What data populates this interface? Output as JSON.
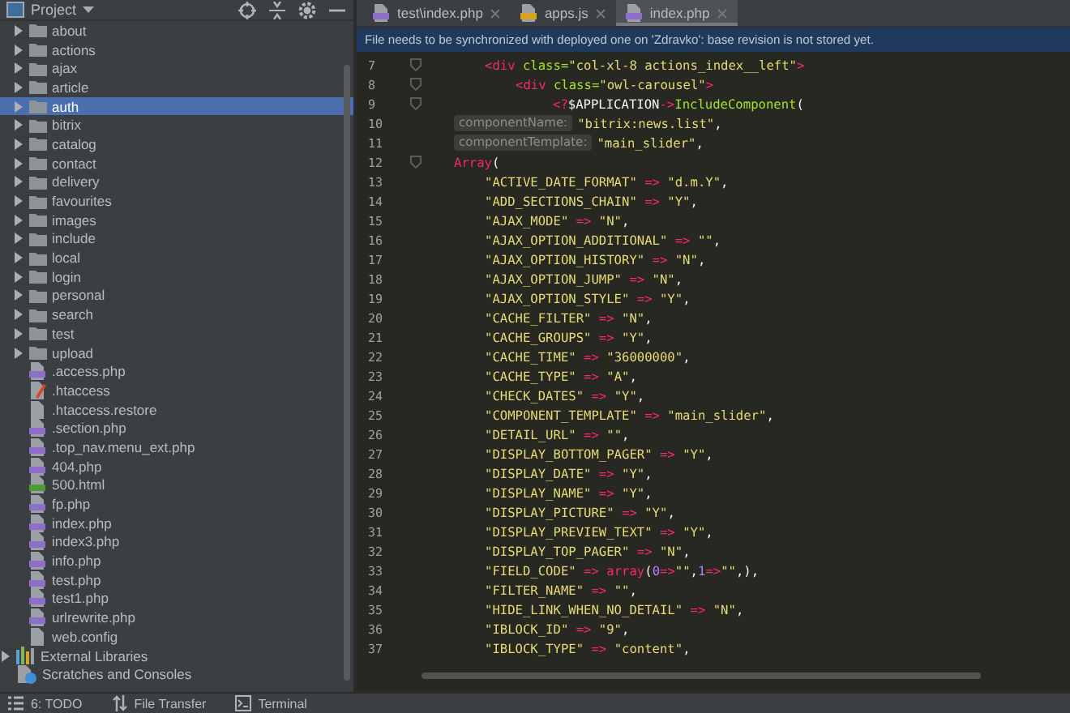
{
  "project_panel": {
    "title": "Project",
    "items": [
      {
        "label": "about",
        "kind": "folder",
        "expanded": false,
        "selected": false
      },
      {
        "label": "actions",
        "kind": "folder",
        "expanded": false,
        "selected": false
      },
      {
        "label": "ajax",
        "kind": "folder",
        "expanded": false,
        "selected": false
      },
      {
        "label": "article",
        "kind": "folder",
        "expanded": false,
        "selected": false
      },
      {
        "label": "auth",
        "kind": "folder",
        "expanded": false,
        "selected": true
      },
      {
        "label": "bitrix",
        "kind": "folder",
        "expanded": false,
        "selected": false
      },
      {
        "label": "catalog",
        "kind": "folder",
        "expanded": false,
        "selected": false
      },
      {
        "label": "contact",
        "kind": "folder",
        "expanded": false,
        "selected": false
      },
      {
        "label": "delivery",
        "kind": "folder",
        "expanded": false,
        "selected": false
      },
      {
        "label": "favourites",
        "kind": "folder",
        "expanded": false,
        "selected": false
      },
      {
        "label": "images",
        "kind": "folder",
        "expanded": false,
        "selected": false
      },
      {
        "label": "include",
        "kind": "folder",
        "expanded": false,
        "selected": false
      },
      {
        "label": "local",
        "kind": "folder",
        "expanded": false,
        "selected": false
      },
      {
        "label": "login",
        "kind": "folder",
        "expanded": false,
        "selected": false
      },
      {
        "label": "personal",
        "kind": "folder",
        "expanded": false,
        "selected": false
      },
      {
        "label": "search",
        "kind": "folder",
        "expanded": false,
        "selected": false
      },
      {
        "label": "test",
        "kind": "folder",
        "expanded": false,
        "selected": false
      },
      {
        "label": "upload",
        "kind": "folder",
        "expanded": false,
        "selected": false
      },
      {
        "label": ".access.php",
        "kind": "php",
        "selected": false
      },
      {
        "label": ".htaccess",
        "kind": "htaccess",
        "selected": false
      },
      {
        "label": ".htaccess.restore",
        "kind": "text",
        "selected": false
      },
      {
        "label": ".section.php",
        "kind": "php",
        "selected": false
      },
      {
        "label": ".top_nav.menu_ext.php",
        "kind": "php",
        "selected": false
      },
      {
        "label": "404.php",
        "kind": "php",
        "selected": false
      },
      {
        "label": "500.html",
        "kind": "html",
        "selected": false
      },
      {
        "label": "fp.php",
        "kind": "php",
        "selected": false
      },
      {
        "label": "index.php",
        "kind": "php",
        "selected": false
      },
      {
        "label": "index3.php",
        "kind": "php",
        "selected": false
      },
      {
        "label": "info.php",
        "kind": "php",
        "selected": false
      },
      {
        "label": "test.php",
        "kind": "php",
        "selected": false
      },
      {
        "label": "test1.php",
        "kind": "php",
        "selected": false
      },
      {
        "label": "urlrewrite.php",
        "kind": "php",
        "selected": false
      },
      {
        "label": "web.config",
        "kind": "text",
        "selected": false
      }
    ],
    "root_items": [
      {
        "label": "External Libraries",
        "kind": "library",
        "expanded": false,
        "selected": false
      },
      {
        "label": "Scratches and Consoles",
        "kind": "scratches",
        "selected": false
      }
    ]
  },
  "tabs": [
    {
      "label": "test\\index.php",
      "kind": "php",
      "selected": false
    },
    {
      "label": "apps.js",
      "kind": "js",
      "selected": false
    },
    {
      "label": "index.php",
      "kind": "php",
      "selected": true
    }
  ],
  "notice": "File needs to be synchronized with deployed one on 'Zdravko': base revision is not stored yet.",
  "lines": [
    {
      "number": "7",
      "fold": true,
      "kind": "outer_tag",
      "tokens": [
        {
          "kind": "tag",
          "text": "<div"
        },
        {
          "kind": "attr",
          "text": " class="
        },
        {
          "kind": "str",
          "text": "\"col-xl-8 actions_index__left\""
        },
        {
          "kind": "tag",
          "text": ">"
        }
      ]
    },
    {
      "number": "8",
      "fold": true,
      "kind": "inner_tag",
      "tokens": [
        {
          "kind": "tag",
          "text": "<div"
        },
        {
          "kind": "attr",
          "text": " class="
        },
        {
          "kind": "str",
          "text": "\"owl-carousel\""
        },
        {
          "kind": "tag",
          "text": ">"
        }
      ]
    },
    {
      "number": "9",
      "fold": true,
      "kind": "php_call",
      "tokens": [
        {
          "kind": "tag",
          "text": "<?"
        },
        {
          "kind": "plain",
          "text": "$APPLICATION"
        },
        {
          "kind": "op",
          "text": "->"
        },
        {
          "kind": "func",
          "text": "IncludeComponent"
        },
        {
          "kind": "plain",
          "text": "("
        }
      ]
    },
    {
      "number": "10",
      "fold": false,
      "kind": "argument",
      "hint": "componentName:",
      "tokens": [
        {
          "kind": "str",
          "text": "\"bitrix:news.list\""
        },
        {
          "kind": "plain",
          "text": ","
        }
      ]
    },
    {
      "number": "11",
      "fold": false,
      "kind": "argument",
      "hint": "componentTemplate:",
      "tokens": [
        {
          "kind": "str",
          "text": "\"main_slider\""
        },
        {
          "kind": "plain",
          "text": ","
        }
      ]
    },
    {
      "number": "12",
      "fold": true,
      "kind": "argument",
      "tokens": [
        {
          "kind": "op",
          "text": "Array"
        },
        {
          "kind": "plain",
          "text": "("
        }
      ]
    },
    {
      "number": "13",
      "fold": false,
      "kind": "entry",
      "tokens": [
        {
          "kind": "str",
          "text": "\"ACTIVE_DATE_FORMAT\""
        },
        {
          "kind": "op",
          "text": " => "
        },
        {
          "kind": "str",
          "text": "\"d.m.Y\""
        },
        {
          "kind": "plain",
          "text": ","
        }
      ]
    },
    {
      "number": "14",
      "fold": false,
      "kind": "entry",
      "tokens": [
        {
          "kind": "str",
          "text": "\"ADD_SECTIONS_CHAIN\""
        },
        {
          "kind": "op",
          "text": " => "
        },
        {
          "kind": "str",
          "text": "\"Y\""
        },
        {
          "kind": "plain",
          "text": ","
        }
      ]
    },
    {
      "number": "15",
      "fold": false,
      "kind": "entry",
      "tokens": [
        {
          "kind": "str",
          "text": "\"AJAX_MODE\""
        },
        {
          "kind": "op",
          "text": " => "
        },
        {
          "kind": "str",
          "text": "\"N\""
        },
        {
          "kind": "plain",
          "text": ","
        }
      ]
    },
    {
      "number": "16",
      "fold": false,
      "kind": "entry",
      "tokens": [
        {
          "kind": "str",
          "text": "\"AJAX_OPTION_ADDITIONAL\""
        },
        {
          "kind": "op",
          "text": " => "
        },
        {
          "kind": "str",
          "text": "\"\""
        },
        {
          "kind": "plain",
          "text": ","
        }
      ]
    },
    {
      "number": "17",
      "fold": false,
      "kind": "entry",
      "tokens": [
        {
          "kind": "str",
          "text": "\"AJAX_OPTION_HISTORY\""
        },
        {
          "kind": "op",
          "text": " => "
        },
        {
          "kind": "str",
          "text": "\"N\""
        },
        {
          "kind": "plain",
          "text": ","
        }
      ]
    },
    {
      "number": "18",
      "fold": false,
      "kind": "entry",
      "tokens": [
        {
          "kind": "str",
          "text": "\"AJAX_OPTION_JUMP\""
        },
        {
          "kind": "op",
          "text": " => "
        },
        {
          "kind": "str",
          "text": "\"N\""
        },
        {
          "kind": "plain",
          "text": ","
        }
      ]
    },
    {
      "number": "19",
      "fold": false,
      "kind": "entry",
      "tokens": [
        {
          "kind": "str",
          "text": "\"AJAX_OPTION_STYLE\""
        },
        {
          "kind": "op",
          "text": " => "
        },
        {
          "kind": "str",
          "text": "\"Y\""
        },
        {
          "kind": "plain",
          "text": ","
        }
      ]
    },
    {
      "number": "20",
      "fold": false,
      "kind": "entry",
      "tokens": [
        {
          "kind": "str",
          "text": "\"CACHE_FILTER\""
        },
        {
          "kind": "op",
          "text": " => "
        },
        {
          "kind": "str",
          "text": "\"N\""
        },
        {
          "kind": "plain",
          "text": ","
        }
      ]
    },
    {
      "number": "21",
      "fold": false,
      "kind": "entry",
      "tokens": [
        {
          "kind": "str",
          "text": "\"CACHE_GROUPS\""
        },
        {
          "kind": "op",
          "text": " => "
        },
        {
          "kind": "str",
          "text": "\"Y\""
        },
        {
          "kind": "plain",
          "text": ","
        }
      ]
    },
    {
      "number": "22",
      "fold": false,
      "kind": "entry",
      "tokens": [
        {
          "kind": "str",
          "text": "\"CACHE_TIME\""
        },
        {
          "kind": "op",
          "text": " => "
        },
        {
          "kind": "str",
          "text": "\"36000000\""
        },
        {
          "kind": "plain",
          "text": ","
        }
      ]
    },
    {
      "number": "23",
      "fold": false,
      "kind": "entry",
      "tokens": [
        {
          "kind": "str",
          "text": "\"CACHE_TYPE\""
        },
        {
          "kind": "op",
          "text": " => "
        },
        {
          "kind": "str",
          "text": "\"A\""
        },
        {
          "kind": "plain",
          "text": ","
        }
      ]
    },
    {
      "number": "24",
      "fold": false,
      "kind": "entry",
      "tokens": [
        {
          "kind": "str",
          "text": "\"CHECK_DATES\""
        },
        {
          "kind": "op",
          "text": " => "
        },
        {
          "kind": "str",
          "text": "\"Y\""
        },
        {
          "kind": "plain",
          "text": ","
        }
      ]
    },
    {
      "number": "25",
      "fold": false,
      "kind": "entry",
      "tokens": [
        {
          "kind": "str",
          "text": "\"COMPONENT_TEMPLATE\""
        },
        {
          "kind": "op",
          "text": " => "
        },
        {
          "kind": "str",
          "text": "\"main_slider\""
        },
        {
          "kind": "plain",
          "text": ","
        }
      ]
    },
    {
      "number": "26",
      "fold": false,
      "kind": "entry",
      "tokens": [
        {
          "kind": "str",
          "text": "\"DETAIL_URL\""
        },
        {
          "kind": "op",
          "text": " => "
        },
        {
          "kind": "str",
          "text": "\"\""
        },
        {
          "kind": "plain",
          "text": ","
        }
      ]
    },
    {
      "number": "27",
      "fold": false,
      "kind": "entry",
      "tokens": [
        {
          "kind": "str",
          "text": "\"DISPLAY_BOTTOM_PAGER\""
        },
        {
          "kind": "op",
          "text": " => "
        },
        {
          "kind": "str",
          "text": "\"Y\""
        },
        {
          "kind": "plain",
          "text": ","
        }
      ]
    },
    {
      "number": "28",
      "fold": false,
      "kind": "entry",
      "tokens": [
        {
          "kind": "str",
          "text": "\"DISPLAY_DATE\""
        },
        {
          "kind": "op",
          "text": " => "
        },
        {
          "kind": "str",
          "text": "\"Y\""
        },
        {
          "kind": "plain",
          "text": ","
        }
      ]
    },
    {
      "number": "29",
      "fold": false,
      "kind": "entry",
      "tokens": [
        {
          "kind": "str",
          "text": "\"DISPLAY_NAME\""
        },
        {
          "kind": "op",
          "text": " => "
        },
        {
          "kind": "str",
          "text": "\"Y\""
        },
        {
          "kind": "plain",
          "text": ","
        }
      ]
    },
    {
      "number": "30",
      "fold": false,
      "kind": "entry",
      "tokens": [
        {
          "kind": "str",
          "text": "\"DISPLAY_PICTURE\""
        },
        {
          "kind": "op",
          "text": " => "
        },
        {
          "kind": "str",
          "text": "\"Y\""
        },
        {
          "kind": "plain",
          "text": ","
        }
      ]
    },
    {
      "number": "31",
      "fold": false,
      "kind": "entry",
      "tokens": [
        {
          "kind": "str",
          "text": "\"DISPLAY_PREVIEW_TEXT\""
        },
        {
          "kind": "op",
          "text": " => "
        },
        {
          "kind": "str",
          "text": "\"Y\""
        },
        {
          "kind": "plain",
          "text": ","
        }
      ]
    },
    {
      "number": "32",
      "fold": false,
      "kind": "entry",
      "tokens": [
        {
          "kind": "str",
          "text": "\"DISPLAY_TOP_PAGER\""
        },
        {
          "kind": "op",
          "text": " => "
        },
        {
          "kind": "str",
          "text": "\"N\""
        },
        {
          "kind": "plain",
          "text": ","
        }
      ]
    },
    {
      "number": "33",
      "fold": false,
      "kind": "entry",
      "tokens": [
        {
          "kind": "str",
          "text": "\"FIELD_CODE\""
        },
        {
          "kind": "op",
          "text": " => "
        },
        {
          "kind": "op",
          "text": "array"
        },
        {
          "kind": "plain",
          "text": "("
        },
        {
          "kind": "num",
          "text": "0"
        },
        {
          "kind": "op",
          "text": "=>"
        },
        {
          "kind": "str",
          "text": "\"\""
        },
        {
          "kind": "plain",
          "text": ","
        },
        {
          "kind": "num",
          "text": "1"
        },
        {
          "kind": "op",
          "text": "=>"
        },
        {
          "kind": "str",
          "text": "\"\""
        },
        {
          "kind": "plain",
          "text": ",),"
        }
      ]
    },
    {
      "number": "34",
      "fold": false,
      "kind": "entry",
      "tokens": [
        {
          "kind": "str",
          "text": "\"FILTER_NAME\""
        },
        {
          "kind": "op",
          "text": " => "
        },
        {
          "kind": "str",
          "text": "\"\""
        },
        {
          "kind": "plain",
          "text": ","
        }
      ]
    },
    {
      "number": "35",
      "fold": false,
      "kind": "entry",
      "tokens": [
        {
          "kind": "str",
          "text": "\"HIDE_LINK_WHEN_NO_DETAIL\""
        },
        {
          "kind": "op",
          "text": " => "
        },
        {
          "kind": "str",
          "text": "\"N\""
        },
        {
          "kind": "plain",
          "text": ","
        }
      ]
    },
    {
      "number": "36",
      "fold": false,
      "kind": "entry",
      "tokens": [
        {
          "kind": "str",
          "text": "\"IBLOCK_ID\""
        },
        {
          "kind": "op",
          "text": " => "
        },
        {
          "kind": "str",
          "text": "\"9\""
        },
        {
          "kind": "plain",
          "text": ","
        }
      ]
    },
    {
      "number": "37",
      "fold": false,
      "kind": "entry",
      "tokens": [
        {
          "kind": "str",
          "text": "\"IBLOCK_TYPE\""
        },
        {
          "kind": "op",
          "text": " => "
        },
        {
          "kind": "str",
          "text": "\"content\""
        },
        {
          "kind": "plain",
          "text": ","
        }
      ]
    }
  ],
  "tool_windows": [
    {
      "label": "6: TODO",
      "kind": "todo"
    },
    {
      "label": "File Transfer",
      "kind": "transfer"
    },
    {
      "label": "Terminal",
      "kind": "terminal"
    }
  ]
}
